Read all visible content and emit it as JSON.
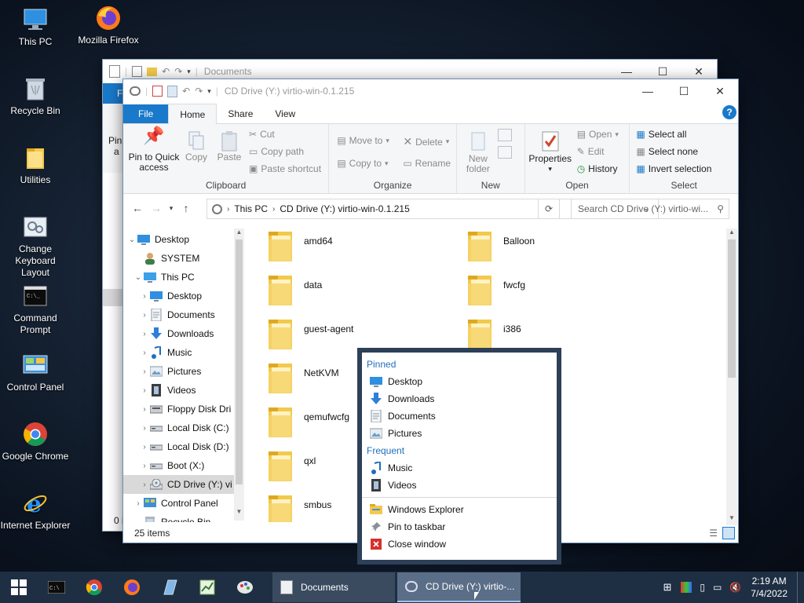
{
  "desktop": {
    "icons": [
      {
        "label": "This PC",
        "icon": "this-pc-icon"
      },
      {
        "label": "Mozilla Firefox",
        "icon": "firefox-icon"
      },
      {
        "label": "Recycle Bin",
        "icon": "recycle-bin-icon"
      },
      {
        "label": "Utilities",
        "icon": "folder-icon"
      },
      {
        "label": "Change Keyboard Layout",
        "icon": "keyboard-settings-icon"
      },
      {
        "label": "Command Prompt",
        "icon": "cmd-icon"
      },
      {
        "label": "Control Panel",
        "icon": "control-panel-icon"
      },
      {
        "label": "Google Chrome",
        "icon": "chrome-icon"
      },
      {
        "label": "Internet Explorer",
        "icon": "ie-icon"
      }
    ]
  },
  "back_window": {
    "title": "Documents",
    "file_tab_fragment": "F",
    "pin_fragment": "Pin",
    "pin_fragment2": "a",
    "status_fragment": "0 i"
  },
  "window": {
    "title": "CD Drive (Y:) virtio-win-0.1.215",
    "tabs": {
      "file": "File",
      "home": "Home",
      "share": "Share",
      "view": "View"
    },
    "ribbon": {
      "clipboard": {
        "pin": "Pin to Quick access",
        "copy": "Copy",
        "paste": "Paste",
        "cut": "Cut",
        "copy_path": "Copy path",
        "paste_shortcut": "Paste shortcut",
        "label": "Clipboard"
      },
      "organize": {
        "move_to": "Move to",
        "copy_to": "Copy to",
        "delete": "Delete",
        "rename": "Rename",
        "label": "Organize"
      },
      "new": {
        "new_folder": "New folder",
        "label": "New"
      },
      "open": {
        "properties": "Properties",
        "open": "Open",
        "edit": "Edit",
        "history": "History",
        "label": "Open"
      },
      "select": {
        "select_all": "Select all",
        "select_none": "Select none",
        "invert": "Invert selection",
        "label": "Select"
      }
    },
    "address": {
      "crumbs": [
        "This PC",
        "CD Drive (Y:) virtio-win-0.1.215"
      ],
      "search_placeholder": "Search CD Drive (Y:) virtio-wi..."
    },
    "tree": [
      {
        "label": "Desktop",
        "icon": "desktop-icon",
        "indent": 0,
        "expand": "open"
      },
      {
        "label": "SYSTEM",
        "icon": "user-icon",
        "indent": 1,
        "expand": "none"
      },
      {
        "label": "This PC",
        "icon": "this-pc-icon",
        "indent": 1,
        "expand": "open"
      },
      {
        "label": "Desktop",
        "icon": "desktop-icon",
        "indent": 2,
        "expand": "closed"
      },
      {
        "label": "Documents",
        "icon": "documents-icon",
        "indent": 2,
        "expand": "closed"
      },
      {
        "label": "Downloads",
        "icon": "downloads-icon",
        "indent": 2,
        "expand": "closed"
      },
      {
        "label": "Music",
        "icon": "music-icon",
        "indent": 2,
        "expand": "closed"
      },
      {
        "label": "Pictures",
        "icon": "pictures-icon",
        "indent": 2,
        "expand": "closed"
      },
      {
        "label": "Videos",
        "icon": "videos-icon",
        "indent": 2,
        "expand": "closed"
      },
      {
        "label": "Floppy Disk Dri",
        "icon": "floppy-icon",
        "indent": 2,
        "expand": "closed"
      },
      {
        "label": "Local Disk (C:)",
        "icon": "drive-icon",
        "indent": 2,
        "expand": "closed"
      },
      {
        "label": "Local Disk (D:)",
        "icon": "drive-icon",
        "indent": 2,
        "expand": "closed"
      },
      {
        "label": "Boot (X:)",
        "icon": "drive-icon",
        "indent": 2,
        "expand": "closed"
      },
      {
        "label": "CD Drive (Y:) vi",
        "icon": "cd-drive-icon",
        "indent": 2,
        "expand": "closed",
        "selected": true
      },
      {
        "label": "Control Panel",
        "icon": "control-panel-icon",
        "indent": 1,
        "expand": "closed"
      },
      {
        "label": "Recycle Bin",
        "icon": "recycle-bin-icon",
        "indent": 1,
        "expand": "none"
      }
    ],
    "folders": [
      {
        "name": "amd64"
      },
      {
        "name": "Balloon"
      },
      {
        "name": "data"
      },
      {
        "name": "fwcfg"
      },
      {
        "name": "guest-agent"
      },
      {
        "name": "i386"
      },
      {
        "name": "NetKVM"
      },
      {
        "name": ""
      },
      {
        "name": "qemufwcfg"
      },
      {
        "name": ""
      },
      {
        "name": "qxl"
      },
      {
        "name": ""
      },
      {
        "name": "smbus"
      },
      {
        "name": ""
      }
    ],
    "status": "25 items"
  },
  "jumplist": {
    "pinned_header": "Pinned",
    "pinned": [
      {
        "label": "Desktop",
        "icon": "desktop-icon"
      },
      {
        "label": "Downloads",
        "icon": "downloads-icon"
      },
      {
        "label": "Documents",
        "icon": "documents-icon"
      },
      {
        "label": "Pictures",
        "icon": "pictures-icon"
      }
    ],
    "frequent_header": "Frequent",
    "frequent": [
      {
        "label": "Music",
        "icon": "music-icon"
      },
      {
        "label": "Videos",
        "icon": "videos-icon"
      }
    ],
    "actions": [
      {
        "label": "Windows Explorer",
        "icon": "explorer-icon"
      },
      {
        "label": "Pin to taskbar",
        "icon": "pin-icon"
      },
      {
        "label": "Close window",
        "icon": "close-window-icon"
      }
    ]
  },
  "taskbar": {
    "windows": [
      {
        "label": "Documents"
      },
      {
        "label": "CD Drive (Y:) virtio-..."
      }
    ],
    "time": "2:19 AM",
    "date": "7/4/2022"
  },
  "colors": {
    "accent": "#1979ca",
    "taskbar": "#1e2f43",
    "jumplist_border": "#2e4057",
    "folder": "#f2c94c"
  }
}
